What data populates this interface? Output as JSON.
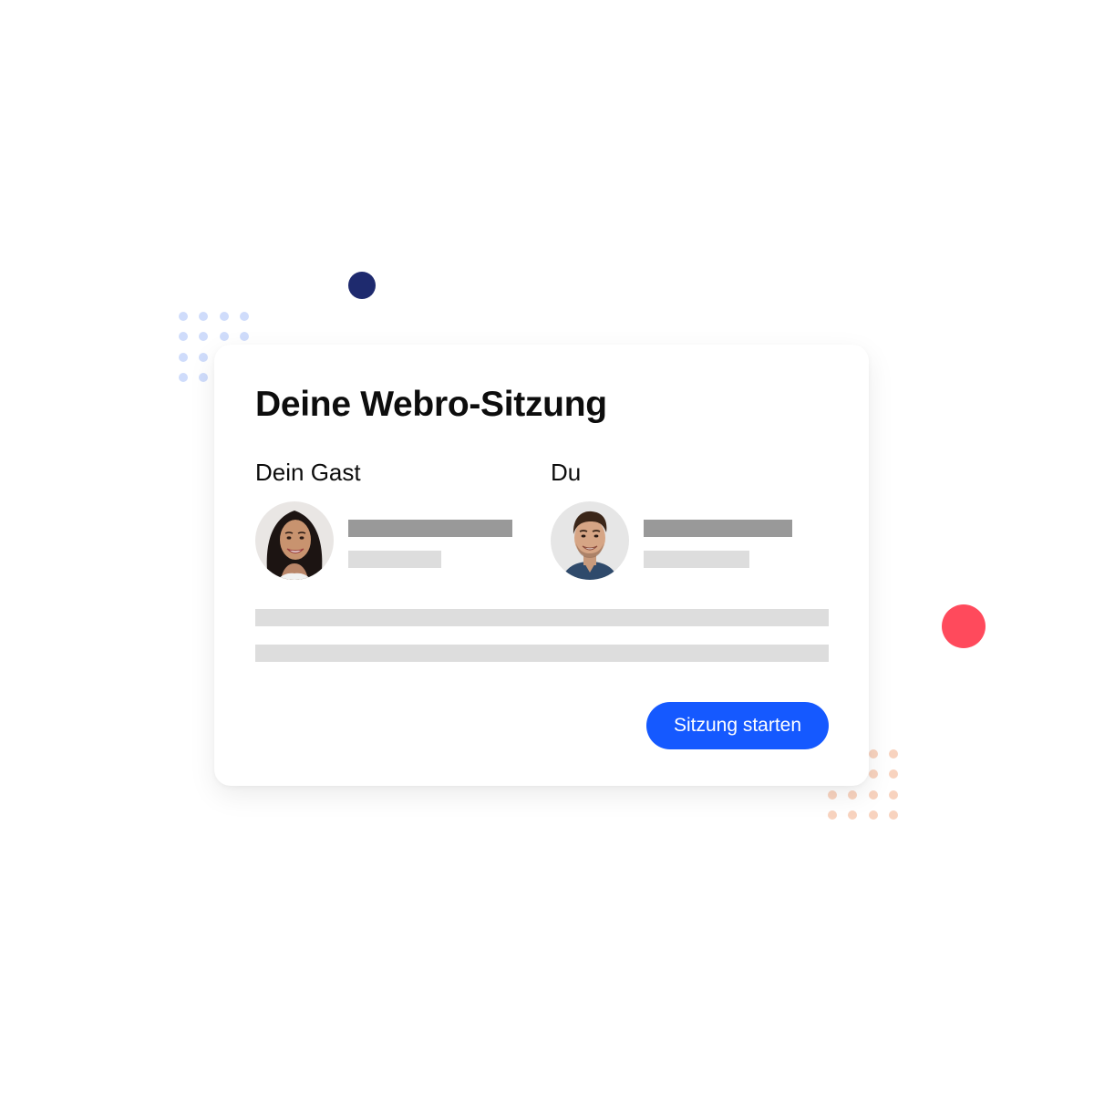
{
  "card": {
    "title": "Deine Webro-Sitzung",
    "guest": {
      "label": "Dein Gast",
      "avatar_icon": "woman-portrait-avatar"
    },
    "you": {
      "label": "Du",
      "avatar_icon": "man-portrait-avatar"
    },
    "start_button_label": "Sitzung starten"
  },
  "colors": {
    "accent": "#1559ff",
    "navy_dot": "#1e2a6e",
    "red_dot": "#ff4a5c",
    "blue_dot_grid": "#cfdcfb",
    "peach_dot_grid": "#f8d3bf",
    "placeholder_dark": "#999999",
    "placeholder_light": "#dddddd"
  }
}
